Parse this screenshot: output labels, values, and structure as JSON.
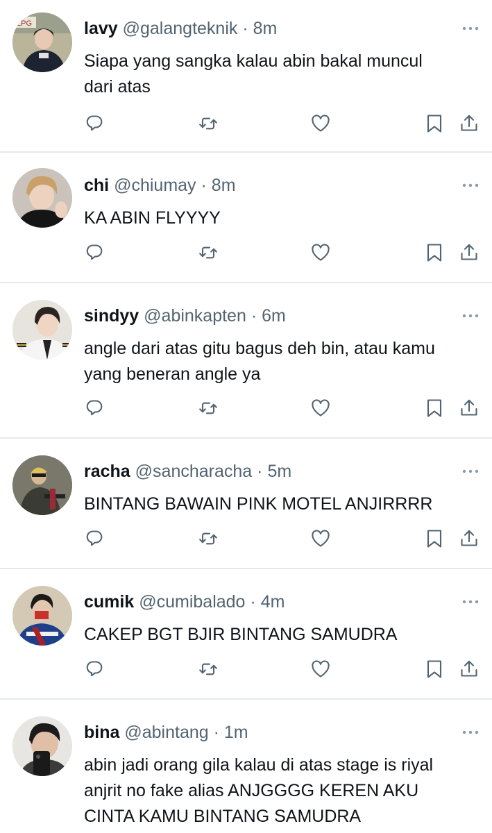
{
  "tweets": [
    {
      "name": "lavy",
      "handle": "@galangteknik",
      "time": "8m",
      "text_lines": [
        "Siapa yang sangka kalau abin bakal muncul",
        "dari atas"
      ],
      "avatar_text": "LPG"
    },
    {
      "name": "chi",
      "handle": "@chiumay",
      "time": "8m",
      "text_lines": [
        "KA ABIN FLYYYY"
      ]
    },
    {
      "name": "sindyy",
      "handle": "@abinkapten",
      "time": "6m",
      "text_lines": [
        "angle dari atas gitu bagus deh bin, atau kamu",
        "yang beneran angle ya"
      ]
    },
    {
      "name": "racha",
      "handle": "@sancharacha",
      "time": "5m",
      "text_lines": [
        "BINTANG BAWAIN PINK MOTEL ANJIRRRR"
      ]
    },
    {
      "name": "cumik",
      "handle": "@cumibalado",
      "time": "4m",
      "text_lines": [
        "CAKEP BGT BJIR BINTANG SAMUDRA"
      ]
    },
    {
      "name": "bina",
      "handle": "@abintang",
      "time": "1m",
      "text_lines": [
        "abin jadi orang gila kalau di atas stage is riyal",
        "anjrit no fake alias ANJGGGG KEREN AKU",
        "CINTA KAMU BINTANG SAMUDRA"
      ]
    }
  ],
  "separator": "·",
  "icons": {
    "reply": "speech-bubble-icon",
    "retweet": "retweet-arrows-icon",
    "like": "heart-icon",
    "bookmark": "bookmark-icon",
    "share": "share-upload-icon",
    "more": "more-dots-icon"
  },
  "colors": {
    "text": "#0f1419",
    "secondary": "#536471",
    "divider": "#e6e9ec",
    "background": "#ffffff"
  }
}
